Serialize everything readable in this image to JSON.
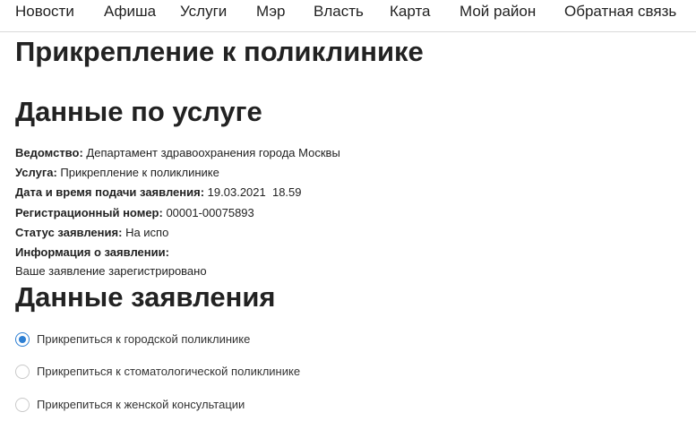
{
  "nav": {
    "items": [
      {
        "label": "Новости"
      },
      {
        "label": "Афиша"
      },
      {
        "label": "Услуги"
      },
      {
        "label": "Мэр"
      },
      {
        "label": "Власть"
      },
      {
        "label": "Карта"
      },
      {
        "label": "Мой район"
      },
      {
        "label": "Обратная связь"
      }
    ]
  },
  "page": {
    "title": "Прикрепление к поликлинике"
  },
  "service": {
    "heading": "Данные по услуге",
    "fields": [
      {
        "label": "Ведомство:",
        "value": "Департамент здравоохранения города Москвы"
      },
      {
        "label": "Услуга:",
        "value": "Прикрепление к поликлинике"
      },
      {
        "label": "Дата и время подачи заявления:",
        "value": "19.03.2021  18.59"
      },
      {
        "label": "Регистрационный номер:",
        "value": "00001-00075893"
      },
      {
        "label": "Статус заявления:",
        "value": "На испо"
      },
      {
        "label": "Информация о заявлении:",
        "value": ""
      }
    ],
    "info_text": "Ваше заявление зарегистрировано"
  },
  "application": {
    "heading": "Данные заявления",
    "options": [
      {
        "label": "Прикрепиться к городской поликлинике",
        "selected": true
      },
      {
        "label": "Прикрепиться к стоматологической поликлинике",
        "selected": false
      },
      {
        "label": "Прикрепиться к женской консультации",
        "selected": false
      }
    ]
  },
  "colors": {
    "accent": "#2d7fd3",
    "text": "#222222",
    "divider": "#d9d9d9"
  }
}
